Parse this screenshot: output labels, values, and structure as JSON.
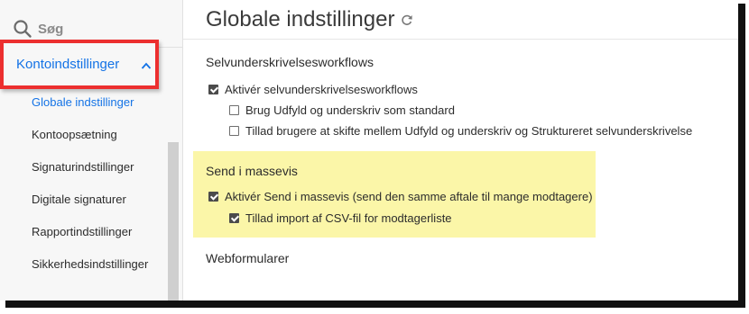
{
  "search": {
    "label": "Søg"
  },
  "sidebar": {
    "section_label": "Kontoindstillinger",
    "items": [
      {
        "label": "Globale indstillinger",
        "active": true
      },
      {
        "label": "Kontoopsætning"
      },
      {
        "label": "Signaturindstillinger"
      },
      {
        "label": "Digitale signaturer"
      },
      {
        "label": "Rapportindstillinger"
      },
      {
        "label": "Sikkerhedsindstillinger"
      }
    ]
  },
  "main": {
    "title": "Globale indstillinger",
    "sections": [
      {
        "title": "Selvunderskrivelsesworkflows",
        "options": [
          {
            "label": "Aktivér selvunderskrivelsesworkflows",
            "checked": true
          },
          {
            "label": "Brug Udfyld og underskriv som standard",
            "checked": false
          },
          {
            "label": "Tillad brugere at skifte mellem Udfyld og underskriv og Struktureret selvunderskrivelse",
            "checked": false
          }
        ]
      },
      {
        "title": "Send i massevis",
        "highlighted": true,
        "options": [
          {
            "label": "Aktivér Send i massevis (send den samme aftale til mange modtagere)",
            "checked": true
          },
          {
            "label": "Tillad import af CSV-fil for modtagerliste",
            "checked": true
          }
        ]
      },
      {
        "title": "Webformularer",
        "options": []
      }
    ]
  },
  "colors": {
    "accent": "#1473e6",
    "callout": "#ec2f2f",
    "highlight": "#fbf6a8"
  }
}
